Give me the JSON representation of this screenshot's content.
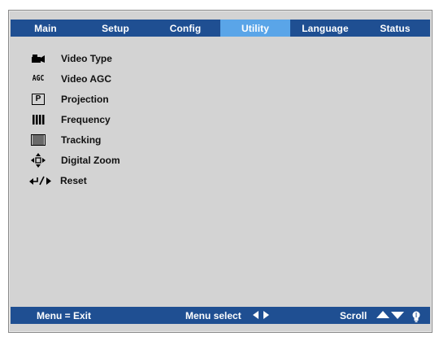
{
  "tabs": [
    {
      "label": "Main",
      "active": false
    },
    {
      "label": "Setup",
      "active": false
    },
    {
      "label": "Config",
      "active": false
    },
    {
      "label": "Utility",
      "active": true
    },
    {
      "label": "Language",
      "active": false
    },
    {
      "label": "Status",
      "active": false
    }
  ],
  "menu": {
    "items": [
      {
        "label": "Video Type",
        "icon": "video-camera-icon"
      },
      {
        "label": "Video AGC",
        "icon": "agc-icon",
        "icon_text": "AGC"
      },
      {
        "label": "Projection",
        "icon": "projection-icon",
        "icon_text": "P"
      },
      {
        "label": "Frequency",
        "icon": "frequency-icon"
      },
      {
        "label": "Tracking",
        "icon": "tracking-icon"
      },
      {
        "label": "Digital Zoom",
        "icon": "move-arrows-icon"
      },
      {
        "label": "Reset",
        "icon": "reset-icon"
      }
    ]
  },
  "footer": {
    "exit_label": "Menu = Exit",
    "select_label": "Menu select",
    "scroll_label": "Scroll"
  },
  "colors": {
    "tab_bar": "#1f4f92",
    "active_tab": "#5aa5e8",
    "panel": "#d3d3d3"
  }
}
